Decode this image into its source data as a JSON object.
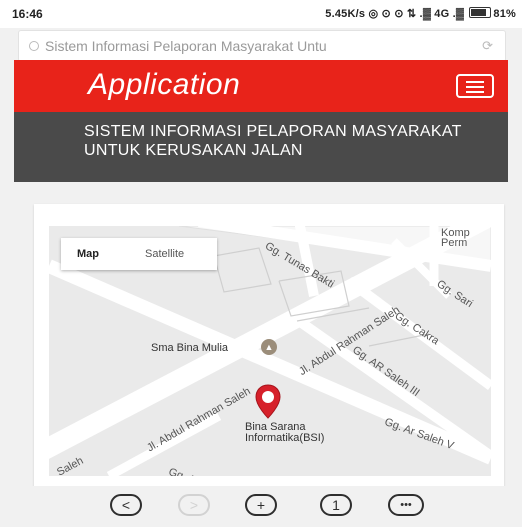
{
  "status_bar": {
    "time": "16:46",
    "speed": "5.45K/s",
    "indicators": "◎ ⊙ ⊙ ⇅ .▓ 4G .▓",
    "battery": "81%"
  },
  "browser": {
    "url": "Sistem Informasi Pelaporan Masyarakat Untu"
  },
  "header": {
    "title": "Application"
  },
  "page": {
    "heading": "SISTEM INFORMASI PELAPORAN MASYARAKAT UNTUK KERUSAKAN JALAN"
  },
  "map": {
    "toggle": {
      "map_label": "Map",
      "satellite_label": "Satellite"
    },
    "labels": {
      "tunas_bakti": "Gg. Tunas Bakti",
      "sari": "Gg. Sari",
      "cakra": "Gg. Cakra",
      "ar_saleh_iii": "Gg. AR Saleh III",
      "ar_saleh_v": "Gg. Ar Saleh V",
      "jl_abdul_1": "Jl. Abdul Rahman Saleh",
      "jl_abdul_2": "Jl. Abdul Rahman Saleh",
      "jl_abdul_3": "Jl. Abdul Rahman Saleh",
      "sma": "Sma Bina Mulia",
      "bsi_1": "Bina Sarana",
      "bsi_2": "Informatika(BSI)",
      "komp_1": "Komp",
      "komp_2": "Perm",
      "saleh_frag": "Saleh",
      "gg_ar_frag": "Gg. Ar"
    }
  },
  "nav": {
    "back": "<",
    "forward": ">",
    "new_tab": "+",
    "tabs": "1",
    "more": "•••"
  },
  "colors": {
    "brand_red": "#e8231a",
    "subhead_gray": "#4a4a4a",
    "pin_red": "#d6202a"
  }
}
